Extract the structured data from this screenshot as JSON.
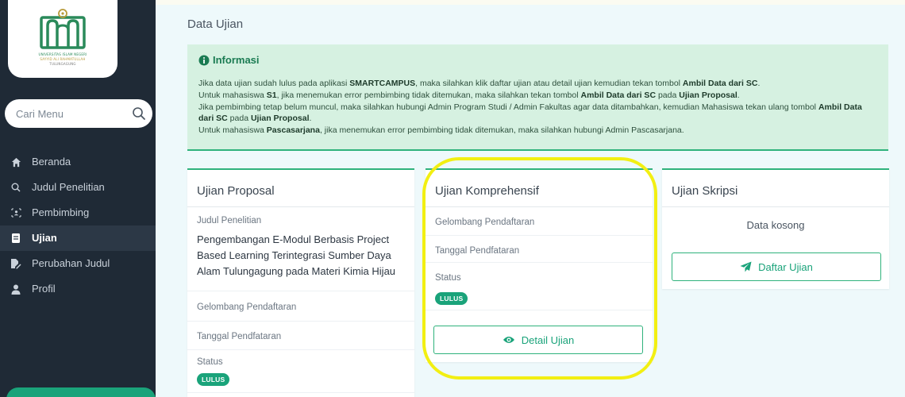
{
  "logo": {
    "line1": "UNIVERSITAS ISLAM NEGERI",
    "line2": "SAYYID ALI RAHMATULLAH",
    "line3": "TULUNGAGUNG"
  },
  "search": {
    "placeholder": "Cari Menu"
  },
  "menu": [
    {
      "label": "Beranda",
      "icon": "home-icon"
    },
    {
      "label": "Judul Penelitian",
      "icon": "search-icon"
    },
    {
      "label": "Pembimbing",
      "icon": "users-icon"
    },
    {
      "label": "Ujian",
      "icon": "clipboard-icon",
      "active": true
    },
    {
      "label": "Perubahan Judul",
      "icon": "edit-file-icon"
    },
    {
      "label": "Profil",
      "icon": "user-icon"
    }
  ],
  "page": {
    "title": "Data Ujian"
  },
  "info": {
    "heading": "Informasi"
  },
  "cards": {
    "proposal": {
      "title": "Ujian Proposal",
      "judul_label": "Judul Penelitian",
      "judul_value": "Pengembangan E-Modul Berbasis Project Based Learning Terintegrasi Sumber Daya Alam Tulungagung pada Materi Kimia Hijau",
      "gelombang_label": "Gelombang Pendaftaran",
      "tanggal_label": "Tanggal Pendfataran",
      "status_label": "Status",
      "status_value": "LULUS"
    },
    "komprehensif": {
      "title": "Ujian Komprehensif",
      "gelombang_label": "Gelombang Pendaftaran",
      "tanggal_label": "Tanggal Pendfataran",
      "status_label": "Status",
      "status_value": "LULUS",
      "button_label": "Detail Ujian"
    },
    "skripsi": {
      "title": "Ujian Skripsi",
      "empty_text": "Data kosong",
      "button_label": "Daftar Ujian"
    }
  },
  "colors": {
    "accent": "#1aa37a",
    "sidebar": "#1f2a36",
    "info_bg": "#d6f1e1",
    "highlight": "#f2ef12"
  }
}
